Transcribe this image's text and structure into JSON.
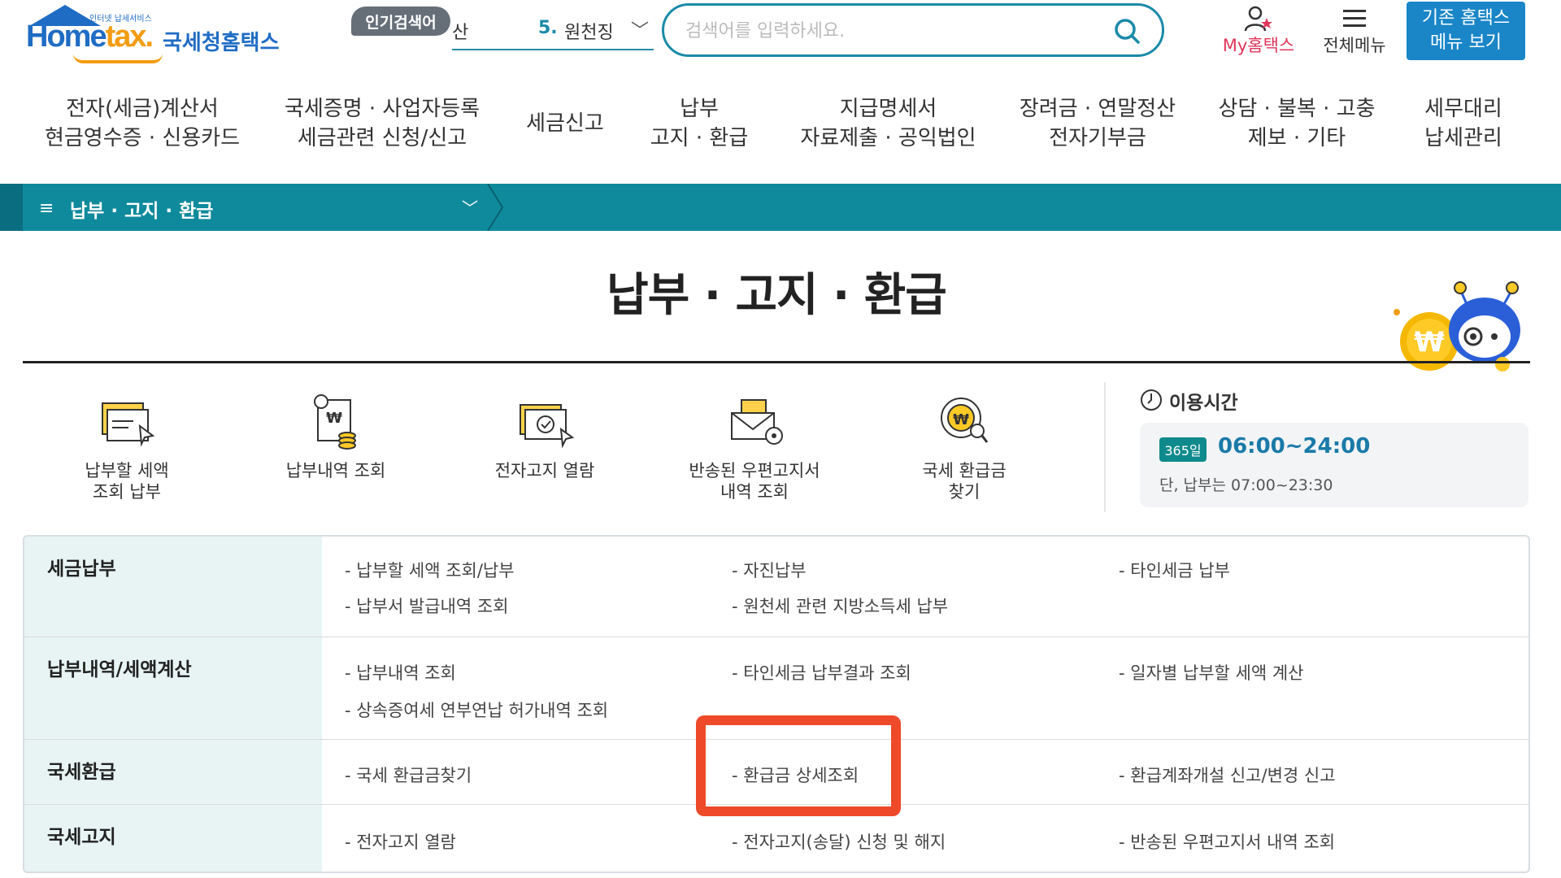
{
  "header": {
    "logo": {
      "main_prefix": "Home",
      "main_suffix": "tax",
      "dot": ".",
      "small": "인터넷 납세서비스",
      "korean": "국세청홈택스"
    },
    "popular": {
      "badge": "인기검색어",
      "left_fragment": "산",
      "rank": "5.",
      "term": "원천징"
    },
    "search": {
      "placeholder": "검색어를 입력하세요."
    },
    "my_hometax": "My홈택스",
    "all_menu": "전체메뉴",
    "old_menu": {
      "line1": "기존 홈택스",
      "line2": "메뉴 보기"
    }
  },
  "nav": [
    {
      "line1": "전자(세금)계산서",
      "line2": "현금영수증 · 신용카드"
    },
    {
      "line1": "국세증명 · 사업자등록",
      "line2": "세금관련 신청/신고"
    },
    {
      "line1": "세금신고",
      "line2": ""
    },
    {
      "line1": "납부",
      "line2": "고지 · 환급"
    },
    {
      "line1": "지급명세서",
      "line2": "자료제출 · 공익법인"
    },
    {
      "line1": "장려금 · 연말정산",
      "line2": "전자기부금"
    },
    {
      "line1": "상담 · 불복 · 고충",
      "line2": "제보 · 기타"
    },
    {
      "line1": "세무대리",
      "line2": "납세관리"
    }
  ],
  "breadcrumb": {
    "label": "납부 · 고지 · 환급"
  },
  "page_title": "납부 · 고지 · 환급",
  "quick_links": [
    {
      "line1": "납부할 세액",
      "line2": "조회 납부",
      "icon": "tax-payment-icon"
    },
    {
      "line1": "납부내역 조회",
      "line2": "",
      "icon": "payment-history-icon"
    },
    {
      "line1": "전자고지 열람",
      "line2": "",
      "icon": "e-notice-icon"
    },
    {
      "line1": "반송된 우편고지서",
      "line2": "내역 조회",
      "icon": "returned-mail-icon"
    },
    {
      "line1": "국세 환급금",
      "line2": "찾기",
      "icon": "refund-search-icon"
    }
  ],
  "hours": {
    "title": "이용시간",
    "badge": "365일",
    "time": "06:00~24:00",
    "note": "단, 납부는 07:00~23:30"
  },
  "menu_rows": [
    {
      "head": "세금납부",
      "links": [
        "- 납부할 세액 조회/납부",
        "- 자진납부",
        "- 타인세금 납부",
        "- 납부서 발급내역 조회",
        "- 원천세 관련 지방소득세 납부"
      ]
    },
    {
      "head": "납부내역/세액계산",
      "links": [
        "- 납부내역 조회",
        "- 타인세금 납부결과 조회",
        "- 일자별 납부할 세액 계산",
        "- 상속증여세 연부연납 허가내역 조회"
      ]
    },
    {
      "head": "국세환급",
      "links": [
        "- 국세 환급금찾기",
        "- 환급금 상세조회",
        "- 환급계좌개설 신고/변경 신고"
      ]
    },
    {
      "head": "국세고지",
      "links": [
        "- 전자고지 열람",
        "- 전자고지(송달) 신청 및 해지",
        "- 반송된 우편고지서 내역 조회"
      ]
    }
  ],
  "colors": {
    "brand_blue": "#1f6cc4",
    "teal_bar": "#0f8a9c",
    "highlight": "#ee4a2a"
  }
}
